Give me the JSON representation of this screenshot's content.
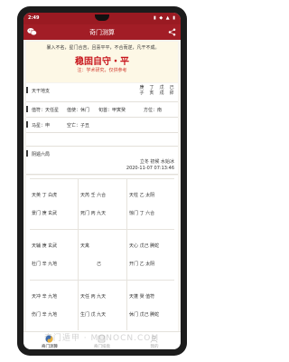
{
  "status": {
    "time": "2:49",
    "icons": "▮ ◆ ▲ ▮"
  },
  "appbar": {
    "title": "奇门测算"
  },
  "intro": {
    "text": "暴入不名，星门合吉，且喜平平，不合而逆，凡干不成。",
    "headline": "稳固自守・平",
    "note": "注：学术研究，仅供参考"
  },
  "tiandi": {
    "label": "天干地支",
    "columns": [
      {
        "top": "庚",
        "bottom": "子"
      },
      {
        "top": "丁",
        "bottom": "亥"
      },
      {
        "top": "戊",
        "bottom": "戌"
      },
      {
        "top": "己",
        "bottom": "卯"
      }
    ]
  },
  "info": {
    "fu": "值符：天任星",
    "shi": "值使：休门",
    "xun": "旬首：甲寅癸",
    "fangwei": "方位：南"
  },
  "ma": {
    "maxing": "马星：申",
    "kongwang": "空亡：子丑"
  },
  "ju": {
    "label": "阴遁六局",
    "jieqi": "立冬 初候 水始冰",
    "date": "2020-11-07 07:13:46"
  },
  "palaces": [
    {
      "l1": "天英  丁  白虎",
      "l2": "景门  庚  玄武"
    },
    {
      "l1": "天芮  壬  六合",
      "l2": "死门  丙  九天"
    },
    {
      "l1": "天柱  乙  太阴",
      "l2": "惊门  丁  六合"
    },
    {
      "l1": "天辅  庚  玄武",
      "l2": "杜门  辛  九地"
    },
    {
      "l1": "天禽",
      "l2": "己"
    },
    {
      "l1": "天心  戊己  腾蛇",
      "l2": "开门  乙  太阴"
    },
    {
      "l1": "天冲  辛  九地",
      "l2": "伤门  辛  九地"
    },
    {
      "l1": "天任  丙  九天",
      "l2": "生门  戊  九天"
    },
    {
      "l1": "天蓬  癸  值符",
      "l2": "休门  戊己  腾蛇"
    }
  ],
  "tabs": [
    {
      "label": "奇门测算"
    },
    {
      "label": "奇门排盘"
    },
    {
      "label": "我的"
    }
  ],
  "watermark": "奇门遁甲 · MONOCN.COM"
}
